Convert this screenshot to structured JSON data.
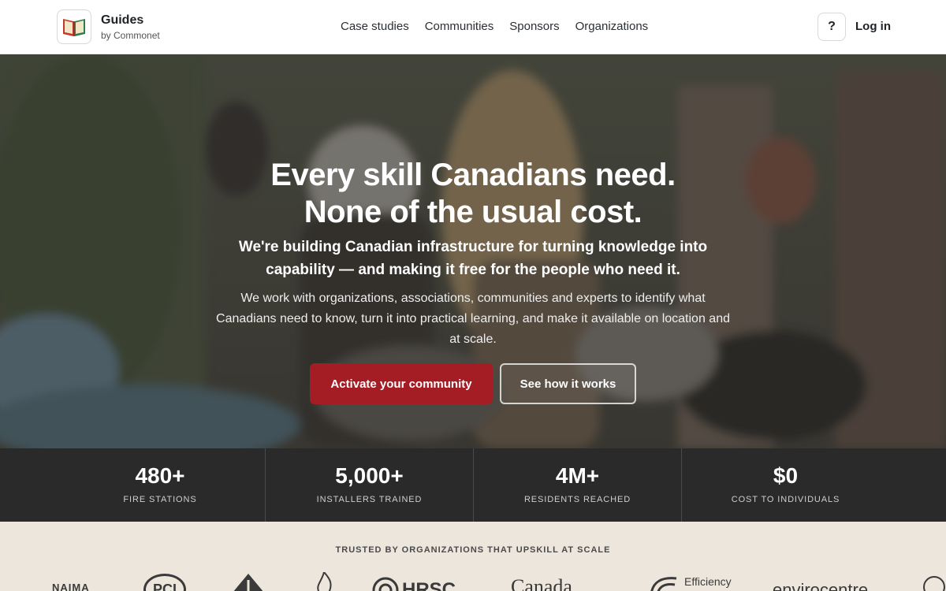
{
  "header": {
    "brand_title": "Guides",
    "brand_sub": "by Commonet",
    "nav": [
      "Case studies",
      "Communities",
      "Sponsors",
      "Organizations"
    ],
    "help_label": "?",
    "login_label": "Log in"
  },
  "hero": {
    "title_line1": "Every skill Canadians need.",
    "title_line2": "None of the usual cost.",
    "lead": "We're building Canadian infrastructure for turning knowledge into capability — and making it free for the people who need it.",
    "body": "We work with organizations, associations, communities and experts to identify what Canadians need to know, turn it into practical learning, and make it available on location and at scale.",
    "primary_cta": "Activate your community",
    "secondary_cta": "See how it works"
  },
  "stats": [
    {
      "value": "480+",
      "label": "FIRE STATIONS"
    },
    {
      "value": "5,000+",
      "label": "INSTALLERS TRAINED"
    },
    {
      "value": "4M+",
      "label": "RESIDENTS REACHED"
    },
    {
      "value": "$0",
      "label": "COST TO INDIVIDUALS"
    }
  ],
  "trusted": {
    "title": "TRUSTED BY ORGANIZATIONS THAT UPSKILL AT SCALE",
    "logos": [
      "NAIMA",
      "PCI",
      "HRSC",
      "Canada",
      "Efficiency",
      "envirocentre"
    ]
  },
  "colors": {
    "accent": "#a51d24",
    "stats_bg": "#2a2a2b",
    "trusted_bg": "#ece6dc"
  }
}
